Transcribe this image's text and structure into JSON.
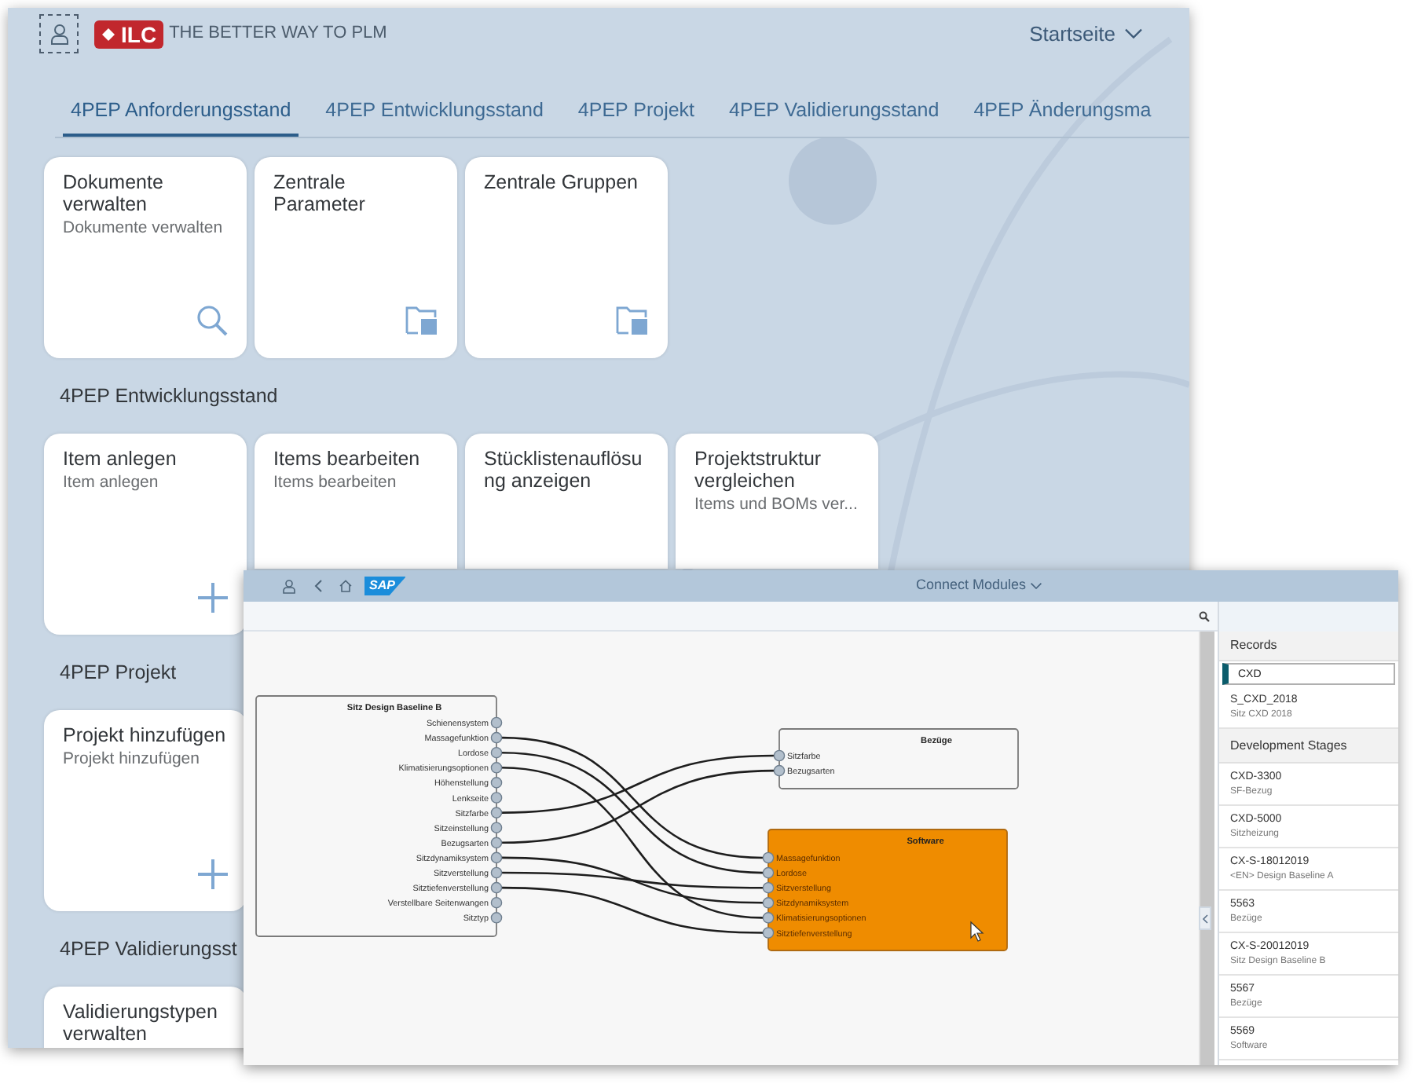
{
  "launchpad": {
    "logo_text": "ILC",
    "tagline": "THE BETTER WAY TO PLM",
    "home_menu": "Startseite",
    "tabs": [
      {
        "label": "4PEP Anforderungsstand",
        "selected": true
      },
      {
        "label": "4PEP Entwicklungsstand",
        "selected": false
      },
      {
        "label": "4PEP Projekt",
        "selected": false
      },
      {
        "label": "4PEP Validierungsstand",
        "selected": false
      },
      {
        "label": "4PEP Änderungsma",
        "selected": false
      }
    ],
    "groups": [
      {
        "tiles": [
          {
            "title": "Dokumente verwalten",
            "subtitle": "Dokumente verwalten",
            "kind": "search"
          },
          {
            "title": "Zentrale Parameter",
            "kind": "folder"
          },
          {
            "title": "Zentrale Gruppen",
            "kind": "folder"
          }
        ]
      },
      {
        "title": "4PEP Entwicklungsstand",
        "tiles": [
          {
            "title": "Item anlegen",
            "subtitle": "Item anlegen",
            "kind": "create"
          },
          {
            "title": "Items bearbeiten",
            "subtitle": "Items bearbeiten",
            "kind": "plain"
          },
          {
            "title": "Stücklistenauflösung anzeigen",
            "kind": "plain"
          },
          {
            "title": "Projektstruktur vergleichen",
            "subtitle": "Items und BOMs ver...",
            "kind": "plain"
          }
        ]
      },
      {
        "title": "4PEP Projekt",
        "tiles": [
          {
            "title": "Projekt hinzufügen",
            "subtitle": "Projekt hinzufügen",
            "kind": "create"
          }
        ]
      },
      {
        "title": "4PEP Validierungsst",
        "tiles": [
          {
            "title": "Validierungstypen verwalten",
            "kind": "plain"
          }
        ]
      }
    ]
  },
  "modules_window": {
    "logo_text": "SAP",
    "title": "Connect Modules",
    "nodes": [
      {
        "title": "Sitz Design Baseline B",
        "selected": false,
        "ports": [
          "Schienensystem",
          "Massagefunktion",
          "Lordose",
          "Klimatisierungsoptionen",
          "Höhenstellung",
          "Lenkseite",
          "Sitzfarbe",
          "Sitzeinstellung",
          "Bezugsarten",
          "Sitzdynamiksystem",
          "Sitzverstellung",
          "Sitztiefenverstellung",
          "Verstellbare Seitenwangen",
          "Sitztyp"
        ]
      },
      {
        "title": "Bezüge",
        "selected": false,
        "ports": [
          "Sitzfarbe",
          "Bezugsarten"
        ]
      },
      {
        "title": "Software",
        "selected": true,
        "ports": [
          "Massagefunktion",
          "Lordose",
          "Sitzverstellung",
          "Sitzdynamiksystem",
          "Klimatisierungsoptionen",
          "Sitztiefenverstellung"
        ]
      }
    ],
    "side_panel": {
      "records_header": "Records",
      "search_value": "CXD",
      "records": [
        {
          "id": "S_CXD_2018",
          "description": "Sitz CXD 2018"
        }
      ],
      "stages_header": "Development Stages",
      "stages": [
        {
          "id": "CXD-3300",
          "description": "SF-Bezug"
        },
        {
          "id": "CXD-5000",
          "description": "Sitzheizung"
        },
        {
          "id": "CX-S-18012019",
          "description": "<EN> Design Baseline A"
        },
        {
          "id": "5563",
          "description": "Bezüge"
        },
        {
          "id": "CX-S-20012019",
          "description": "Sitz Design Baseline B"
        },
        {
          "id": "5567",
          "description": "Bezüge"
        },
        {
          "id": "5569",
          "description": "Software"
        }
      ]
    }
  }
}
